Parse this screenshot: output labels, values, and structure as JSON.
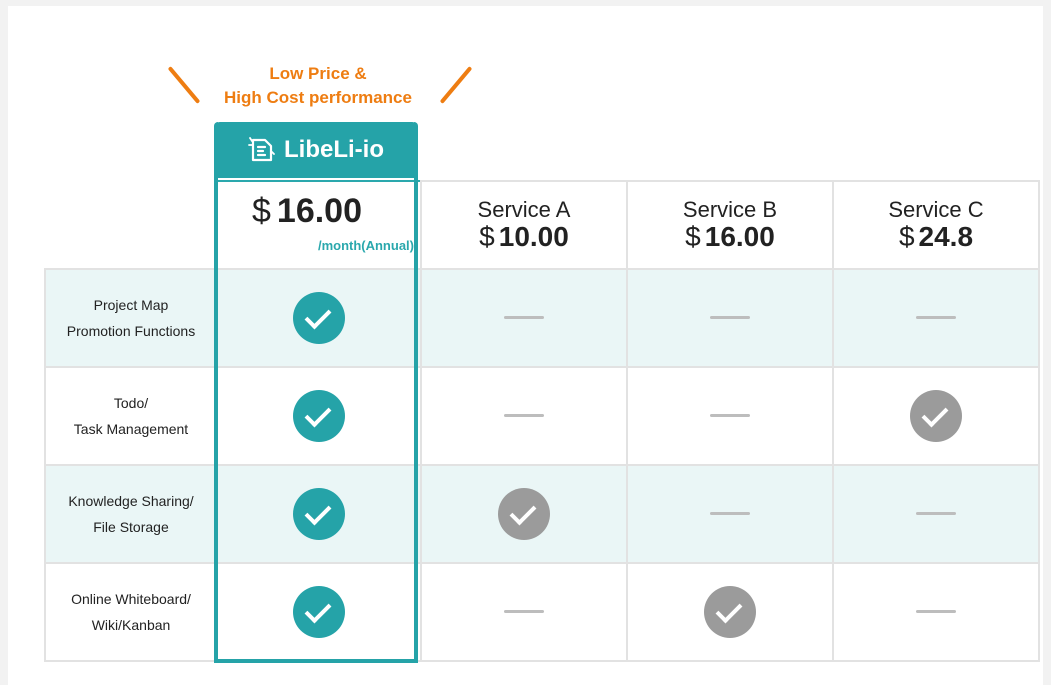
{
  "promo": {
    "line1": "Low Price &",
    "line2": "High Cost performance"
  },
  "featured": {
    "name": "LibeLi-io",
    "currency": "$",
    "price": "16.00",
    "period": "/month(Annual)",
    "brand_color": "#25a3a8"
  },
  "services": [
    {
      "name": "Service A",
      "currency": "$",
      "price": "10.00"
    },
    {
      "name": "Service B",
      "currency": "$",
      "price": "16.00"
    },
    {
      "name": "Service C",
      "currency": "$",
      "price": "24.8"
    }
  ],
  "features": [
    {
      "line1": "Project Map",
      "line2": "Promotion Functions",
      "values": [
        "check",
        "dash",
        "dash",
        "dash"
      ]
    },
    {
      "line1": "Todo/",
      "line2": "Task Management",
      "values": [
        "check",
        "dash",
        "dash",
        "check"
      ]
    },
    {
      "line1": "Knowledge Sharing/",
      "line2": "File Storage",
      "values": [
        "check",
        "check",
        "dash",
        "dash"
      ]
    },
    {
      "line1": "Online Whiteboard/",
      "line2": "Wiki/Kanban",
      "values": [
        "check",
        "dash",
        "check",
        "dash"
      ]
    }
  ],
  "colors": {
    "accent_orange": "#ee7d12",
    "featured_check": "#25a3a8",
    "other_check": "#9b9b9b",
    "shaded_row": "#eaf6f6"
  },
  "icons": {
    "check": "check-circle-icon",
    "dash": "dash-icon",
    "logo": "libeli-logo-icon"
  }
}
